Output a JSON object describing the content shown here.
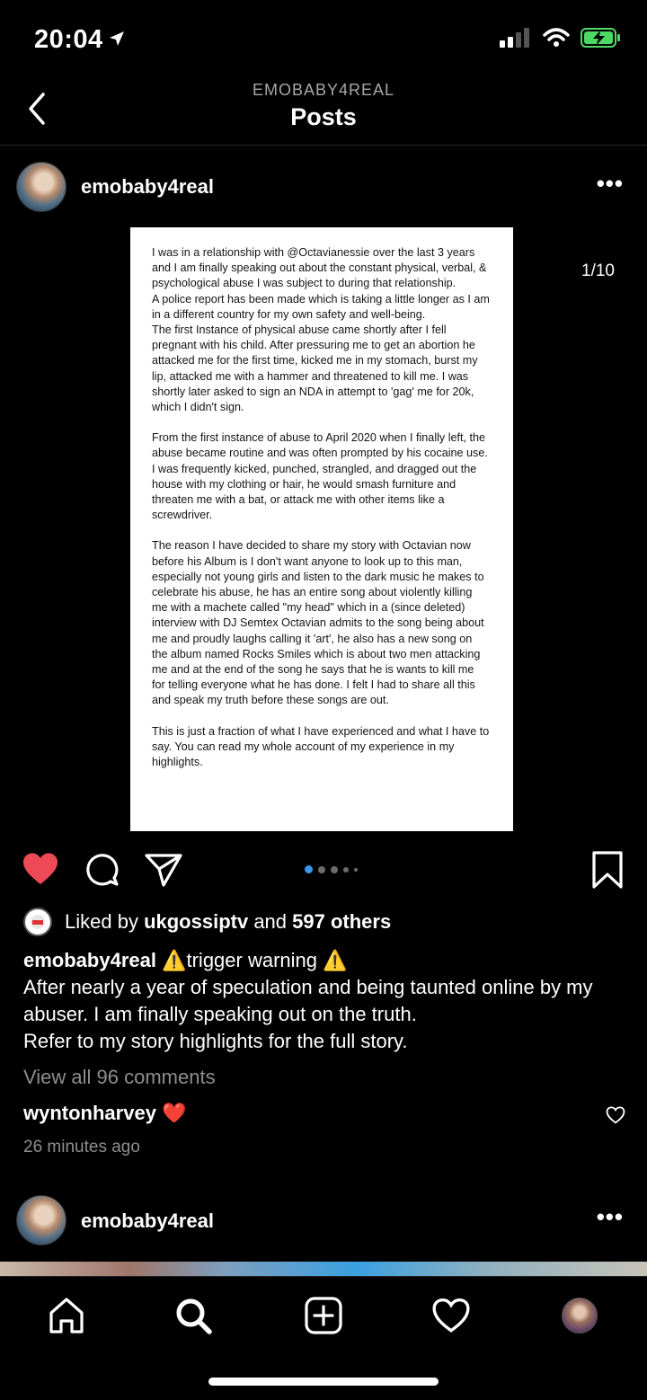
{
  "status_bar": {
    "time": "20:04",
    "battery_color": "#4cd964"
  },
  "nav": {
    "account": "EMOBABY4REAL",
    "title": "Posts"
  },
  "post": {
    "username": "emobaby4real",
    "page_counter": "1/10",
    "card_paragraphs": [
      "I was in a relationship with @Octavianessie over the last 3 years and I am finally speaking out about the constant physical, verbal, & psychological abuse I was subject to during that relationship.",
      "A police report has been made which is taking a little longer as I am in a different country for my own safety and well-being.",
      "The first Instance of physical abuse came shortly after I fell pregnant with his child. After pressuring me to get an abortion he attacked me for the first time, kicked me in my stomach, burst my lip, attacked me with a hammer and threatened to kill me. I was shortly later asked to sign an NDA in attempt to 'gag' me for 20k, which I didn't sign.",
      "From the first instance of abuse to April 2020 when I finally left, the abuse became routine and was often prompted by his cocaine use. I was frequently kicked, punched, strangled, and dragged out the house with my clothing or hair, he would smash furniture and threaten me with a bat, or attack me with other items like a screwdriver.",
      "The reason I have decided to share my story with Octavian now before his Album is I don't want anyone to look up to this man, especially not young girls and listen to the dark music he makes to celebrate his abuse, he has an entire song about violently killing me with a machete called \"my head\" which in a (since deleted) interview with DJ Semtex Octavian admits to the song being about me and proudly laughs calling it 'art', he also has a new song on the album named Rocks Smiles which is about two men attacking me and at the end of the song he says that he is wants to kill me for telling everyone what he has done. I felt I had to share all this and speak my truth before these songs are out.",
      "This is just a fraction of what I have experienced and what I have to say. You can read my whole account of my experience in my highlights."
    ],
    "liked_by_prefix": "Liked by ",
    "liked_by_user": "ukgossiptv",
    "liked_by_and": " and ",
    "liked_by_others": "597 others",
    "caption_username": "emobaby4real",
    "caption_warning": "⚠️trigger warning ⚠️",
    "caption_lines": [
      "After nearly a year of speculation and being taunted online by my abuser. I am finally speaking out on the truth.",
      "Refer to my story highlights for the full story."
    ],
    "view_comments": "View all 96 comments",
    "comment_user": "wyntonharvey",
    "comment_text": "❤️",
    "timestamp": "26 minutes ago",
    "like_color": "#ed4956",
    "dot_active_color": "#3897f0"
  },
  "next_post": {
    "username": "emobaby4real"
  },
  "icons": [
    "back-chevron-icon",
    "heart-icon",
    "comment-icon",
    "share-icon",
    "bookmark-icon",
    "home-icon",
    "search-icon",
    "new-post-icon",
    "activity-icon"
  ]
}
